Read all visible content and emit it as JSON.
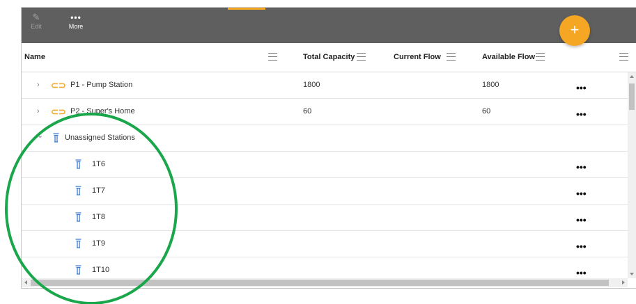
{
  "toolbar": {
    "edit_label": "Edit",
    "more_label": "More",
    "more_icon": "•••",
    "add_icon": "+"
  },
  "columns": [
    {
      "label": "Name"
    },
    {
      "label": "Total Capacity"
    },
    {
      "label": "Current Flow"
    },
    {
      "label": "Available Flow"
    }
  ],
  "rows": [
    {
      "name": "P1 - Pump Station",
      "icon": "pump-icon",
      "total_capacity": "1800",
      "current_flow": "",
      "available_flow": "1800",
      "expander": "›",
      "actions": "•••"
    },
    {
      "name": "P2 - Super's Home",
      "icon": "pump-icon",
      "total_capacity": "60",
      "current_flow": "",
      "available_flow": "60",
      "expander": "›",
      "actions": "•••"
    },
    {
      "name": "Unassigned Stations",
      "icon": "tower-icon",
      "expander": "⌄"
    },
    {
      "name": "1T6",
      "icon": "tower-icon",
      "actions": "•••"
    },
    {
      "name": "1T7",
      "icon": "tower-icon",
      "actions": "•••"
    },
    {
      "name": "1T8",
      "icon": "tower-icon",
      "actions": "•••"
    },
    {
      "name": "1T9",
      "icon": "tower-icon",
      "actions": "•••"
    },
    {
      "name": "1T10",
      "icon": "tower-icon",
      "actions": "•••"
    }
  ],
  "colors": {
    "toolbar_bg": "#5f5f5f",
    "accent": "#f5a623",
    "tower_icon": "#3a7bd5",
    "annotation_circle": "#1aa64a"
  }
}
